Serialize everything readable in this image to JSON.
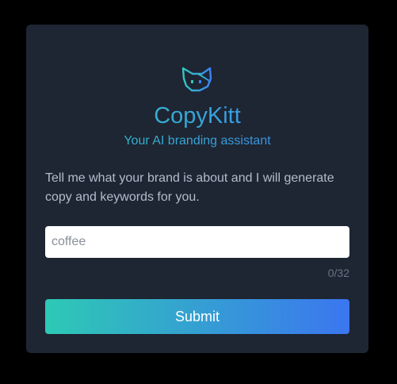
{
  "app": {
    "title": "CopyKitt",
    "subtitle": "Your AI branding assistant"
  },
  "form": {
    "prompt": "Tell me what your brand is about and I will generate copy and keywords for you.",
    "input_placeholder": "coffee",
    "input_value": "",
    "char_counter": "0/32",
    "submit_label": "Submit"
  },
  "icons": {
    "logo": "cat-face-icon"
  },
  "colors": {
    "background": "#000000",
    "card": "#1e2533",
    "gradient_start": "#32c8b9",
    "gradient_end": "#3b82f6",
    "text_muted": "#b4bccb"
  }
}
